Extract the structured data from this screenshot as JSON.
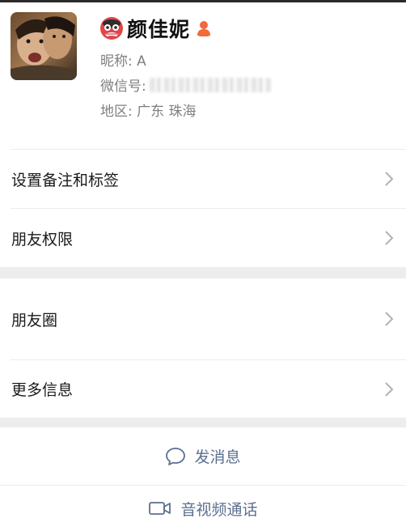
{
  "profile": {
    "name": "颜佳妮",
    "nickname_label": "昵称:",
    "nickname_value": "A",
    "wechat_id_label": "微信号:",
    "region_label": "地区:",
    "region_value": "广东  珠海",
    "gender": "female"
  },
  "menu": {
    "group1": [
      {
        "label": "设置备注和标签"
      },
      {
        "label": "朋友权限"
      }
    ],
    "group2": [
      {
        "label": "朋友圈"
      },
      {
        "label": "更多信息"
      }
    ]
  },
  "actions": {
    "send_message": "发消息",
    "av_call": "音视频通话"
  },
  "colors": {
    "action_text": "#5c6f8f",
    "gender_icon": "#f06a3a",
    "section_gap": "#ededed"
  },
  "icons": [
    "avatar-photo",
    "emoji-mask-icon",
    "gender-person-icon",
    "chevron-right-icon",
    "chat-bubble-icon",
    "video-camera-icon"
  ]
}
